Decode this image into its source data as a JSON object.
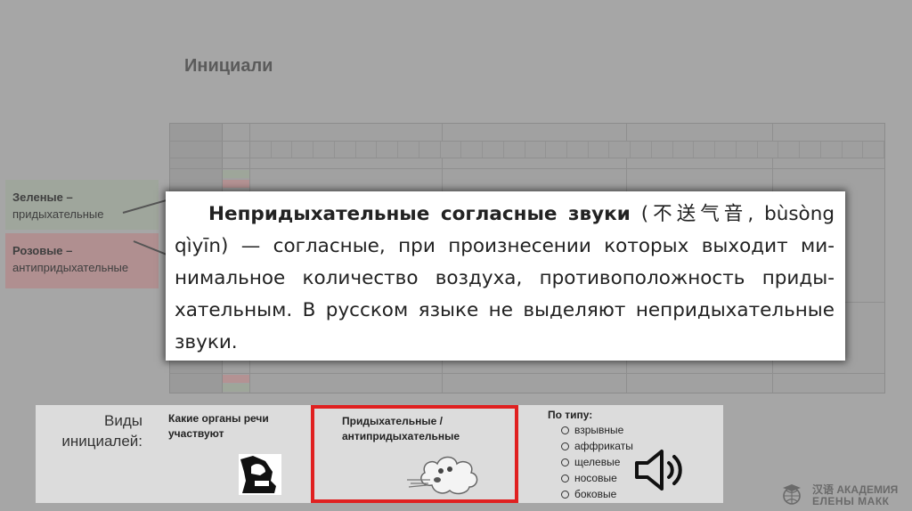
{
  "slide": {
    "title": "Инициали"
  },
  "legend": {
    "green_title": "Зеленые –",
    "green_sub": "придыхательные",
    "pink_title": "Розовые –",
    "pink_sub": "антипридыхательные",
    "colors": {
      "green": "#9fa69c",
      "pink": "#b08f90"
    }
  },
  "popup": {
    "term": "Непридыхательные согласные звуки",
    "text_before": " (",
    "chinese": "不送气音",
    "pinyin": ", bùsòng qìyīn",
    "definition": ") — согласные, при произнесении которых выходит ми­нимальное количество воздуха, противоположность приды­хательным. В русском языке не выделяют непридыхательные звуки."
  },
  "bottom": {
    "types_label": "Виды инициалей:",
    "organs_label": "Какие органы речи участвуют",
    "aspiration_label": "Придыхательные / антипридыхательные",
    "by_type_label": "По типу:",
    "by_type_items": [
      "взрывные",
      "аффрикаты",
      "щелевые",
      "носовые",
      "боковые"
    ],
    "highlight_color": "#e02020"
  },
  "watermark": {
    "line1": "汉语 АКАДЕМИЯ",
    "line2": "ЕЛЕНЫ МАКК"
  },
  "icons": [
    "mouth-profile-icon",
    "blowing-cloud-icon",
    "speaker-icon",
    "graduation-globe-icon"
  ]
}
